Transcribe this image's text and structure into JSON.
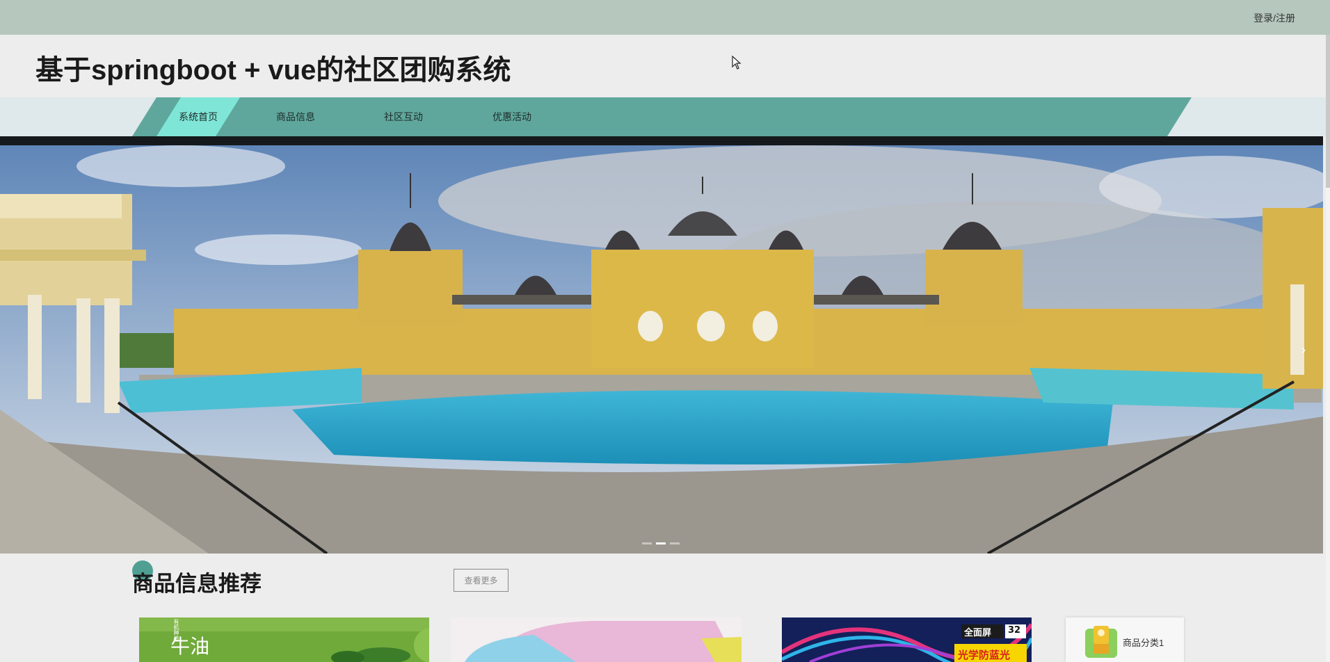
{
  "topbar": {
    "login_label": "登录/注册"
  },
  "header": {
    "title": "基于springboot + vue的社区团购系统"
  },
  "nav": {
    "items": [
      {
        "label": "系统首页",
        "active": true
      },
      {
        "label": "商品信息",
        "active": false
      },
      {
        "label": "社区互动",
        "active": false
      },
      {
        "label": "优惠活动",
        "active": false
      }
    ]
  },
  "banner": {
    "next_icon": "chevron-right-icon",
    "slide_count": 3,
    "active_slide": 1
  },
  "recommend": {
    "title": "商品信息推荐",
    "more_label": "查看更多",
    "products": [
      {
        "image_text": "牛油",
        "side_text": "有机种植"
      },
      {
        "image_text": ""
      },
      {
        "badge_top": "全面屏",
        "badge_num": "32",
        "badge_bottom": "光学防蓝光"
      }
    ],
    "category": {
      "label": "商品分类1"
    }
  },
  "colors": {
    "topbar": "#b6c7bd",
    "nav_band": "#5fa79d",
    "nav_active": "#7fe6d7",
    "accent": "#4fa092"
  }
}
